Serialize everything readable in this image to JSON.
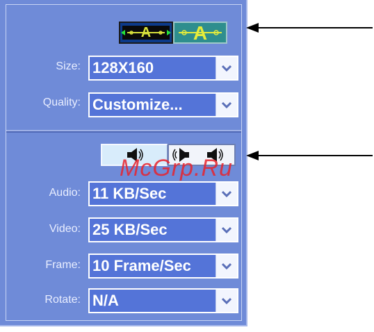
{
  "video": {
    "size": {
      "label": "Size:",
      "value": "128X160"
    },
    "quality": {
      "label": "Quality:",
      "value": "Customize..."
    }
  },
  "media": {
    "audio": {
      "label": "Audio:",
      "value": "11 KB/Sec"
    },
    "video": {
      "label": "Video:",
      "value": "25 KB/Sec"
    },
    "frame": {
      "label": "Frame:",
      "value": "10 Frame/Sec"
    },
    "rotate": {
      "label": "Rotate:",
      "value": "N/A"
    }
  },
  "watermark": "McGrp.Ru",
  "colors": {
    "panel": "#6f8bd8",
    "select_bg": "#5474d8",
    "mode_active": "#0c3a8a",
    "mode_inactive": "#2e8e8e",
    "watermark": "#e8232d"
  },
  "icons": {
    "video_mode_1": "stretch-a-icon",
    "video_mode_2": "fit-a-icon",
    "audio_mode_1": "speaker-icon",
    "audio_mode_2": "speaker-pair-icon",
    "dropdown": "chevron-down-icon"
  }
}
